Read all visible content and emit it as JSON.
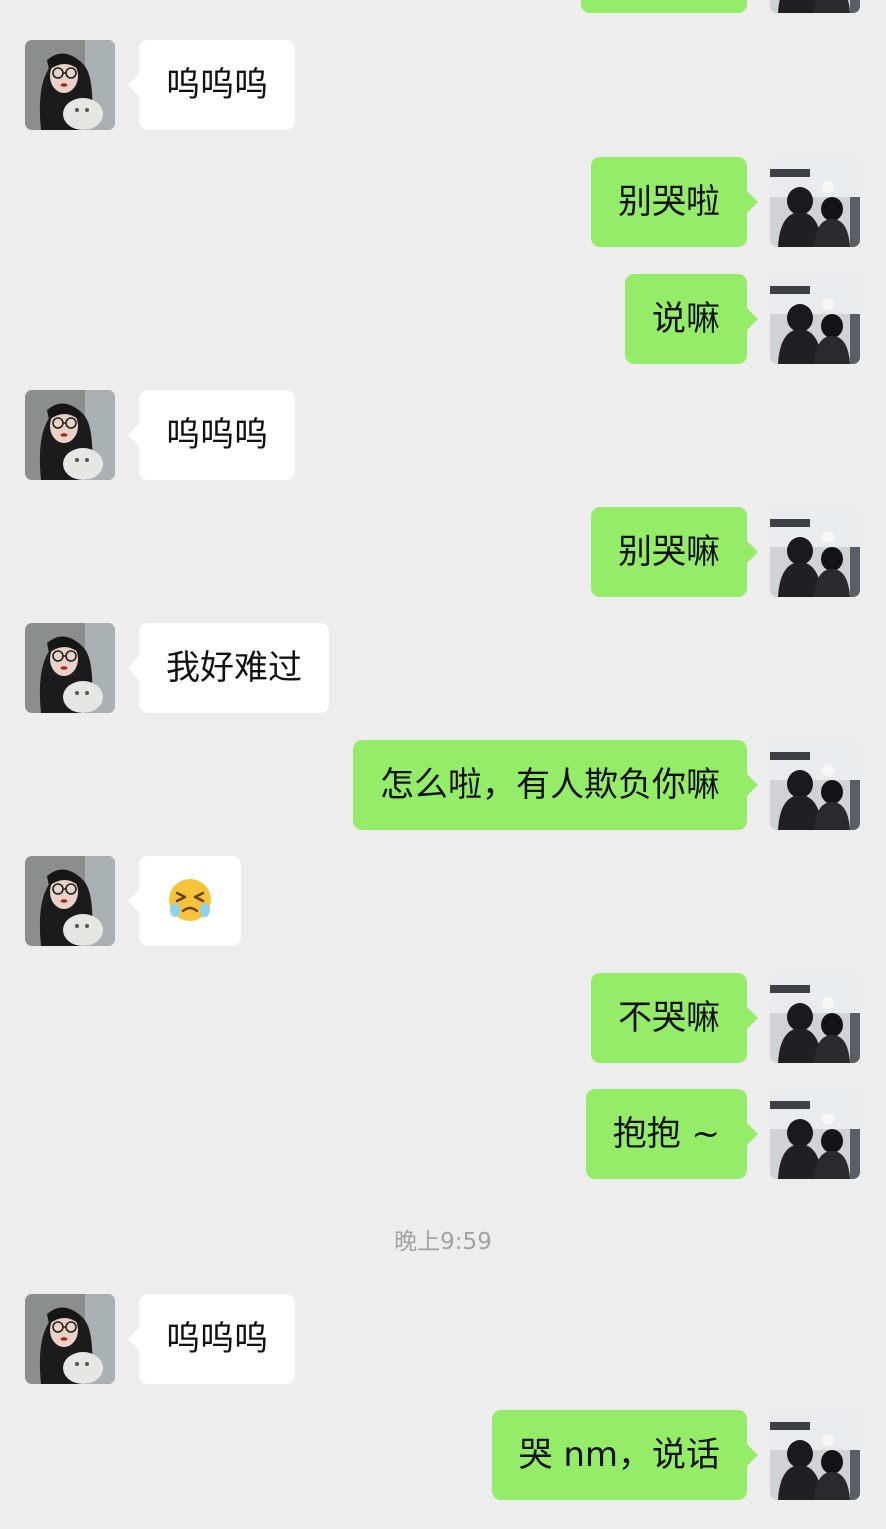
{
  "colors": {
    "background": "#ededed",
    "incoming_bubble": "#ffffff",
    "outgoing_bubble": "#95ec69",
    "timestamp_text": "#a3a3a3"
  },
  "messages": [
    {
      "side": "right",
      "text": "",
      "avatar": "friend-avatar"
    },
    {
      "side": "left",
      "text": "呜呜呜",
      "avatar": "girl-avatar"
    },
    {
      "side": "right",
      "text": "别哭啦",
      "avatar": "boy-avatar"
    },
    {
      "side": "right",
      "text": "说嘛",
      "avatar": "boy-avatar"
    },
    {
      "side": "left",
      "text": "呜呜呜",
      "avatar": "girl-avatar"
    },
    {
      "side": "right",
      "text": "别哭嘛",
      "avatar": "boy-avatar"
    },
    {
      "side": "left",
      "text": "我好难过",
      "avatar": "girl-avatar"
    },
    {
      "side": "right",
      "text": "怎么啦，有人欺负你嘛",
      "avatar": "boy-avatar"
    },
    {
      "side": "left",
      "emoji": "crying-angry-emoji",
      "avatar": "girl-avatar"
    },
    {
      "side": "right",
      "text": "不哭嘛",
      "avatar": "boy-avatar"
    },
    {
      "side": "right",
      "text": "抱抱 ~",
      "avatar": "boy-avatar"
    },
    {
      "side": "left",
      "text": "呜呜呜",
      "avatar": "girl-avatar"
    },
    {
      "side": "right",
      "text": "哭 nm，说话",
      "avatar": "boy-avatar"
    }
  ],
  "timestamp": "晚上9:59"
}
